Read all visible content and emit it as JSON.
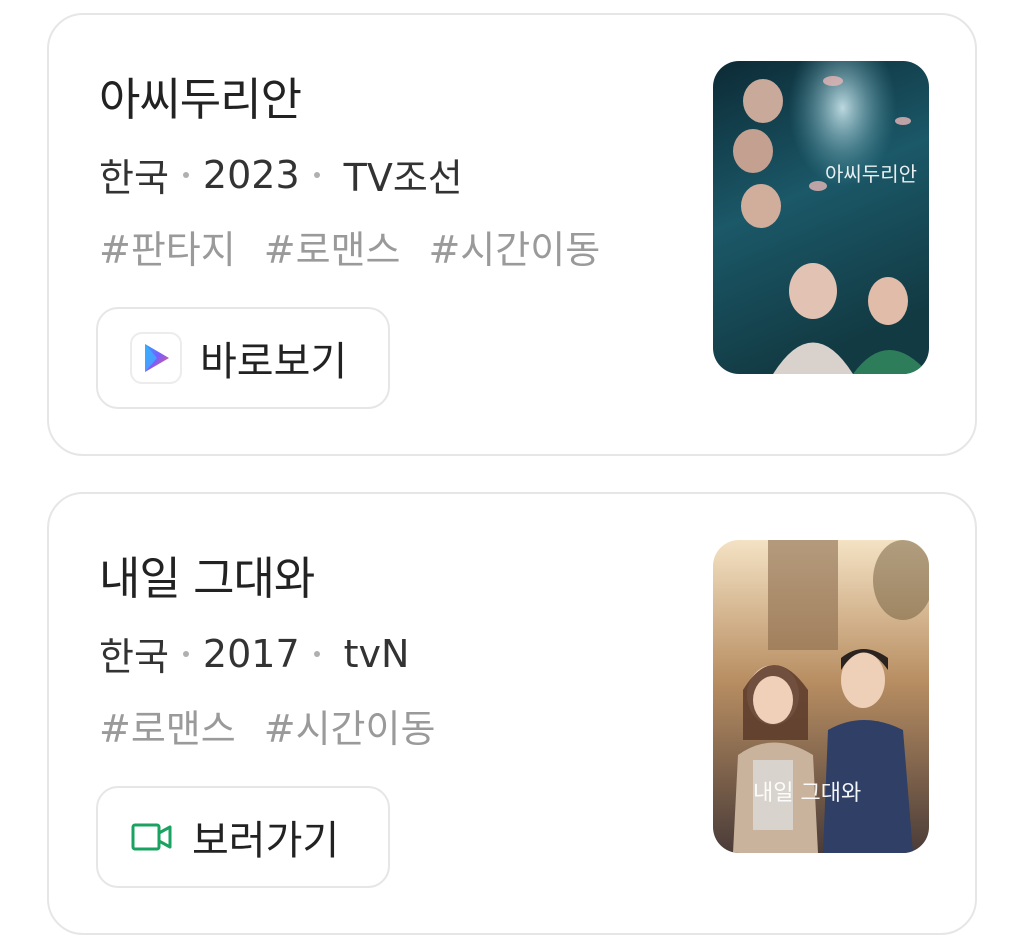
{
  "results": [
    {
      "title": "아씨두리안",
      "country": "한국",
      "year": "2023",
      "network": "TV조선",
      "tags": [
        "#판타지",
        "#로맨스",
        "#시간이동"
      ],
      "action_label": "바로보기",
      "action_icon": "play-store-icon",
      "poster_text": "아씨두리안",
      "poster_colors": [
        "#0f2f3c",
        "#1d5f6e",
        "#2a7f7a"
      ]
    },
    {
      "title": "내일 그대와",
      "country": "한국",
      "year": "2017",
      "network": "tvN",
      "tags": [
        "#로맨스",
        "#시간이동"
      ],
      "action_label": "보러가기",
      "action_icon": "video-camera-icon",
      "poster_text": "내일 그대와",
      "poster_colors": [
        "#f3d9b3",
        "#8a6b4e",
        "#3a3a4a"
      ]
    }
  ],
  "colors": {
    "border": "#e6e6e6",
    "title": "#222222",
    "meta": "#333333",
    "tag": "#9a9a9a",
    "video_icon": "#1aa260"
  }
}
